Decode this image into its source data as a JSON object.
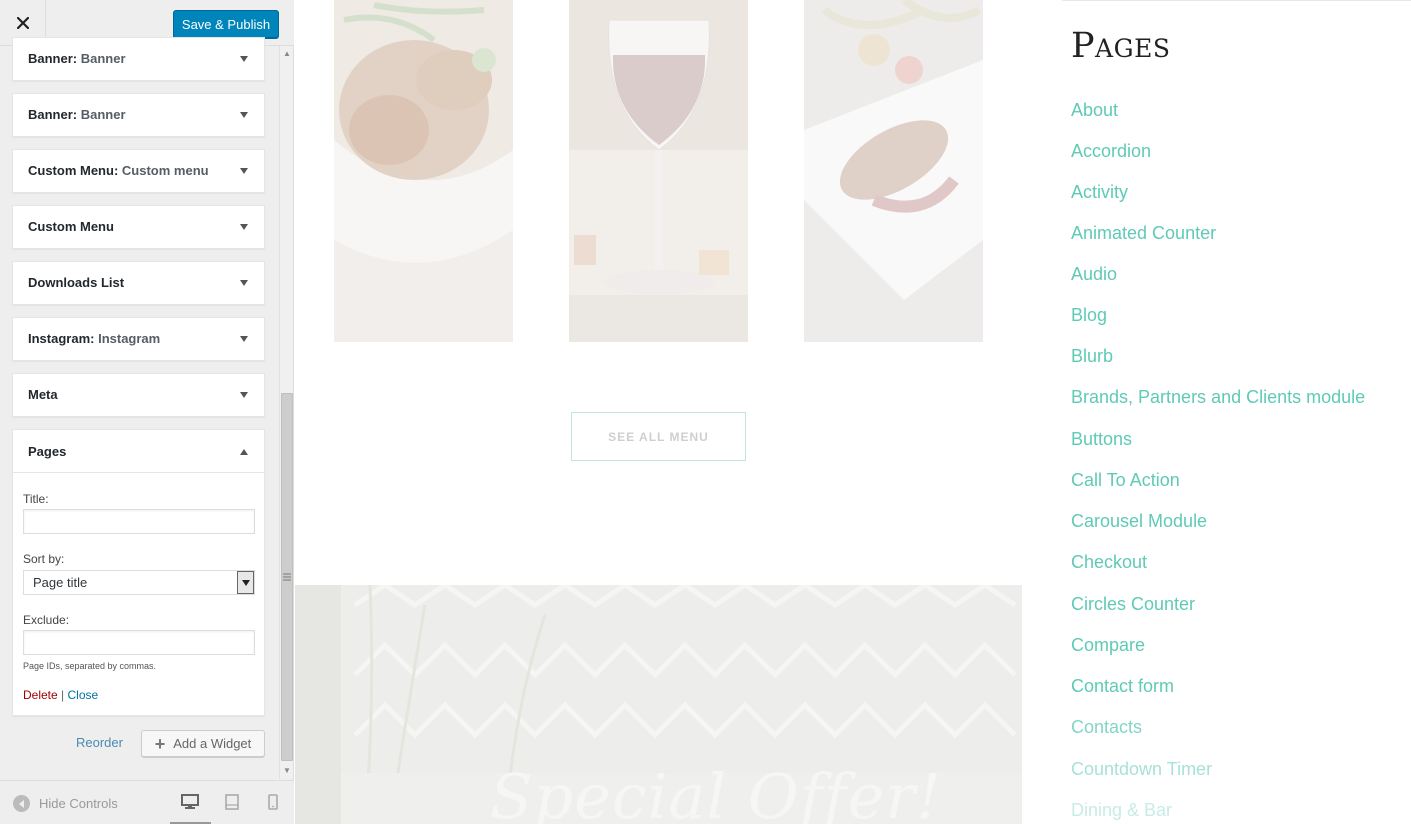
{
  "header": {
    "close_label": "×",
    "save_publish_label": "Save & Publish"
  },
  "widgets": [
    {
      "title": "Banner",
      "subtitle": "Banner"
    },
    {
      "title": "Banner",
      "subtitle": "Banner"
    },
    {
      "title": "Custom Menu",
      "subtitle": "Custom menu"
    },
    {
      "title": "Custom Menu",
      "subtitle": ""
    },
    {
      "title": "Downloads List",
      "subtitle": ""
    },
    {
      "title": "Instagram",
      "subtitle": "Instagram"
    },
    {
      "title": "Meta",
      "subtitle": ""
    }
  ],
  "open_widget": {
    "title": "Pages",
    "title_label": "Title:",
    "title_value": "",
    "sort_by_label": "Sort by:",
    "sort_by_value": "Page title",
    "exclude_label": "Exclude:",
    "exclude_value": "",
    "help_text": "Page IDs, separated by commas.",
    "delete_label": "Delete",
    "separator": "|",
    "close_label": "Close"
  },
  "actions": {
    "reorder_label": "Reorder",
    "add_widget_label": "Add a Widget"
  },
  "footer": {
    "hide_controls_label": "Hide Controls",
    "devices": [
      "desktop-icon",
      "tablet-icon",
      "mobile-icon"
    ],
    "active_device": "desktop"
  },
  "preview": {
    "see_all_label": "SEE ALL MENU",
    "special_offer_text": "Special Offer!"
  },
  "pages_widget": {
    "heading": "Pages",
    "links": [
      "About",
      "Accordion",
      "Activity",
      "Animated Counter",
      "Audio",
      "Blog",
      "Blurb",
      "Brands, Partners and Clients module",
      "Buttons",
      "Call To Action",
      "Carousel Module",
      "Checkout",
      "Circles Counter",
      "Compare",
      "Contact form",
      "Contacts",
      "Countdown Timer",
      "Dining & Bar"
    ]
  },
  "colors": {
    "accent_button": "#0085ba",
    "page_link": "#5fcab6",
    "delete_link": "#a00000",
    "close_link": "#0073aa"
  }
}
